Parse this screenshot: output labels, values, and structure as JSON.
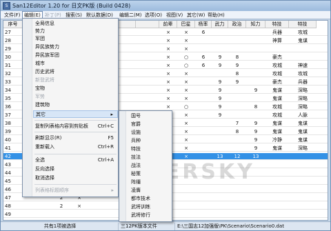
{
  "window": {
    "title": "San12Editor 1.20 for 日文PK版 (Build 0428)",
    "icon": "app-icon"
  },
  "menubar": [
    {
      "label": "文件(F)",
      "state": "normal"
    },
    {
      "label": "编辑(E)",
      "state": "open"
    },
    {
      "label": "补丁(P)",
      "state": "dim"
    },
    {
      "label": "搜索(S)",
      "state": "normal"
    },
    {
      "label": "默认数据(D)",
      "state": "normal"
    },
    {
      "label": "编辑二(M)",
      "state": "normal"
    },
    {
      "label": "选项(O)",
      "state": "normal"
    },
    {
      "label": "视图(V)",
      "state": "normal"
    },
    {
      "label": "其它(W)",
      "state": "normal"
    },
    {
      "label": "帮助(H)",
      "state": "normal"
    }
  ],
  "table": {
    "headers": [
      "序号",
      "名",
      "",
      "",
      "",
      "",
      "",
      "前辈",
      "巴星",
      "杨率",
      "武力",
      "政治",
      "知力",
      "特技",
      "特技"
    ],
    "rows": [
      {
        "id": "27",
        "c7": "×",
        "c8": "×",
        "c9": "6",
        "c10": "",
        "c11": "",
        "c12": "",
        "c13": "兵器",
        "c14": "攻城"
      },
      {
        "id": "28",
        "c7": "×",
        "c8": "×",
        "c9": "",
        "c10": "",
        "c11": "",
        "c12": "",
        "c13": "神算",
        "c14": "鬼谋"
      },
      {
        "id": "29",
        "c7": "×",
        "c8": "×",
        "c9": "",
        "c10": "",
        "c11": "",
        "c12": "",
        "c13": "",
        "c14": ""
      },
      {
        "id": "30",
        "c7": "×",
        "c8": "○",
        "c9": "6",
        "c10": "9",
        "c11": "8",
        "c12": "",
        "c13": "豪杰",
        "c14": ""
      },
      {
        "id": "31",
        "c7": "×",
        "c8": "○",
        "c9": "6",
        "c10": "9",
        "c11": "9",
        "c12": "",
        "c13": "攻城",
        "c14": "神速"
      },
      {
        "id": "32",
        "c7": "×",
        "c8": "×",
        "c9": "",
        "c10": "",
        "c11": "8",
        "c12": "",
        "c13": "攻城",
        "c14": "攻城"
      },
      {
        "id": "33",
        "c7": "×",
        "c8": "×",
        "c9": "",
        "c10": "9",
        "c11": "9",
        "c12": "",
        "c13": "豪杰",
        "c14": "兵器"
      },
      {
        "id": "34",
        "c7": "×",
        "c8": "×",
        "c9": "",
        "c10": "9",
        "c11": "",
        "c12": "9",
        "c13": "鬼谋",
        "c14": "深略"
      },
      {
        "id": "35",
        "c7": "×",
        "c8": "×",
        "c9": "",
        "c10": "9",
        "c11": "",
        "c12": "",
        "c13": "鬼谋",
        "c14": "深略"
      },
      {
        "id": "36",
        "c7": "×",
        "c8": "○",
        "c9": "",
        "c10": "9",
        "c11": "",
        "c12": "8",
        "c13": "攻城",
        "c14": "深略"
      },
      {
        "id": "37",
        "c7": "×",
        "c8": "×",
        "c9": "",
        "c10": "9",
        "c11": "",
        "c12": "",
        "c13": "攻城",
        "c14": "人脉"
      },
      {
        "id": "38",
        "c7": "×",
        "c8": "×",
        "c9": "",
        "c10": "",
        "c11": "7",
        "c12": "9",
        "c13": "鬼谋",
        "c14": "鬼谋"
      },
      {
        "id": "39",
        "c7": "×",
        "c8": "×",
        "c9": "",
        "c10": "",
        "c11": "8",
        "c12": "9",
        "c13": "鬼谋",
        "c14": "鬼谋"
      },
      {
        "id": "40",
        "c7": "×",
        "c8": "×",
        "c9": "",
        "c10": "",
        "c11": "",
        "c12": "9",
        "c13": "冷静",
        "c14": "鬼谋"
      },
      {
        "id": "41",
        "c7": "×",
        "c8": "×",
        "c9": "",
        "c10": "",
        "c11": "",
        "c12": "9",
        "c13": "鬼谋",
        "c14": "深略"
      },
      {
        "id": "42",
        "c7": "×",
        "c8": "×",
        "c9": "",
        "c10": "13",
        "c11": "12",
        "c12": "13",
        "c13": "",
        "c14": ""
      },
      {
        "id": "43",
        "c7": "",
        "c8": "",
        "c9": "",
        "c10": "",
        "c11": "",
        "c12": "",
        "c13": "",
        "c14": ""
      },
      {
        "id": "44",
        "c7": "",
        "c8": "",
        "c9": "",
        "c10": "",
        "c11": "",
        "c12": "",
        "c13": "",
        "c14": ""
      },
      {
        "id": "45",
        "c7": "",
        "c8": "",
        "c9": "",
        "c10": "",
        "c11": "",
        "c12": "",
        "c13": "",
        "c14": ""
      },
      {
        "id": "46",
        "c7": "",
        "c8": "",
        "c9": "",
        "c10": "",
        "c11": "",
        "c12": "",
        "c13": "",
        "c14": ""
      },
      {
        "id": "47",
        "c7": "",
        "c8": "",
        "c9": "",
        "c10": "",
        "c11": "",
        "c12": "",
        "c13": "",
        "c14": ""
      },
      {
        "id": "48",
        "c7": "",
        "c8": "",
        "c9": "",
        "c10": "",
        "c11": "",
        "c12": "",
        "c13": "",
        "c14": ""
      },
      {
        "id": "49",
        "c7": "",
        "c8": "",
        "c9": "",
        "c10": "",
        "c11": "",
        "c12": "",
        "c13": "",
        "c14": ""
      }
    ],
    "selected_row": "42"
  },
  "leftcol": {
    "r43": {
      "a": "2",
      "b": "×"
    },
    "r46": {
      "a": "2",
      "b": "×"
    },
    "r47": {
      "a": "2",
      "b": "×"
    },
    "r48": {
      "a": "2",
      "b": "×"
    }
  },
  "dropdown": {
    "items": [
      {
        "label": "全局信息",
        "shortcut": "",
        "disabled": false
      },
      {
        "label": "势力",
        "shortcut": "",
        "disabled": false
      },
      {
        "label": "军团",
        "shortcut": "",
        "disabled": false
      },
      {
        "label": "异民族势力",
        "shortcut": "",
        "disabled": false
      },
      {
        "label": "异民族军团",
        "shortcut": "",
        "disabled": false
      },
      {
        "label": "城市",
        "shortcut": "",
        "disabled": false
      },
      {
        "label": "历史武将",
        "shortcut": "",
        "disabled": false
      },
      {
        "label": "新登武将",
        "shortcut": "",
        "disabled": true
      },
      {
        "label": "宝物",
        "shortcut": "",
        "disabled": false
      },
      {
        "label": "军势",
        "shortcut": "",
        "disabled": true
      },
      {
        "label": "建筑物",
        "shortcut": "",
        "disabled": false
      },
      {
        "label": "其它",
        "shortcut": "▸",
        "disabled": false
      },
      {
        "label": "复制列表格内容到剪贴板",
        "shortcut": "Ctrl+C",
        "disabled": false
      },
      {
        "label": "刷新显示(R)",
        "shortcut": "F5",
        "disabled": false
      },
      {
        "label": "重新载入",
        "shortcut": "Ctrl+R",
        "disabled": false
      },
      {
        "label": "全选",
        "shortcut": "Ctrl+A",
        "disabled": false
      },
      {
        "label": "反向选择",
        "shortcut": "",
        "disabled": false
      },
      {
        "label": "取消选择",
        "shortcut": "",
        "disabled": false
      },
      {
        "label": "列表格标题顺序",
        "shortcut": "▸",
        "disabled": true
      }
    ]
  },
  "submenu": {
    "items": [
      "国号",
      "官爵",
      "设施",
      "兵种",
      "特技",
      "技法",
      "战法",
      "秘策",
      "阵缰",
      "凌膺",
      "都市技术",
      "武将训练",
      "武将修行"
    ]
  },
  "status": {
    "selected": "共有1项被选择",
    "file": "三12PK版本文件",
    "path": "E:\\三国志12加强版\\PK\\Scenario\\Scenario0.dat"
  },
  "watermark": "GAMERSKY"
}
